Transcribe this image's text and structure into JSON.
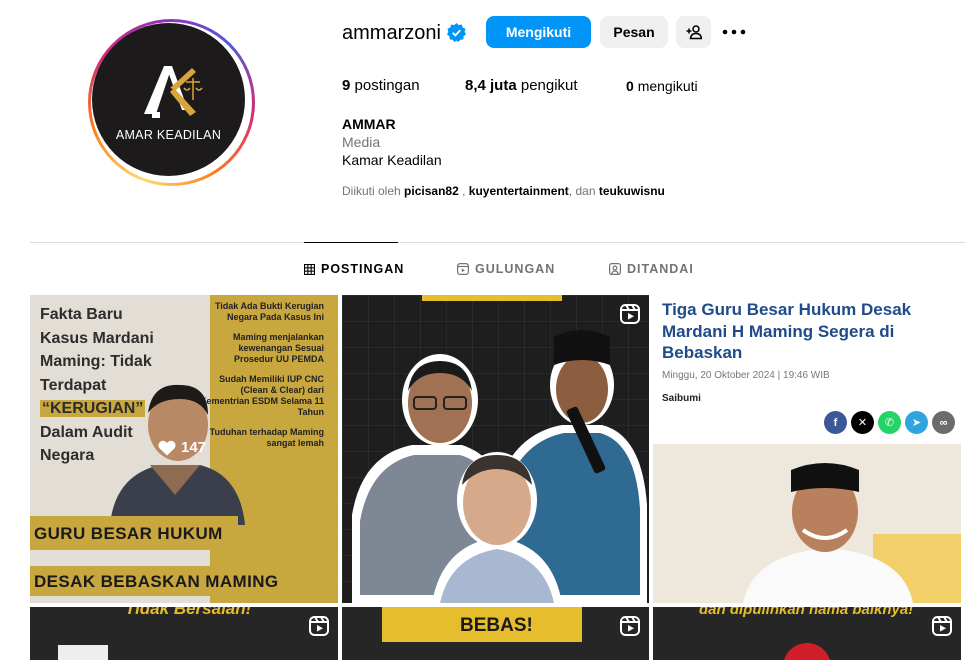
{
  "profile": {
    "avatar_text": "AMAR KEADILAN",
    "username": "ammarzoni",
    "verified": true,
    "follow_label": "Mengikuti",
    "message_label": "Pesan",
    "stats": {
      "posts_count": "9",
      "posts_label": "postingan",
      "followers_count": "8,4 juta",
      "followers_label": "pengikut",
      "following_count": "0",
      "following_label": "mengikuti"
    },
    "display_name": "AMMAR",
    "category": "Media",
    "bio": "Kamar Keadilan",
    "followed_by": {
      "prefix": "Diikuti oleh",
      "user1": "picisan82",
      "sep": ",",
      "user2": "kuyentertainment",
      "and": ", dan",
      "user3": "teukuwisnu"
    }
  },
  "tabs": [
    {
      "label": "POSTINGAN",
      "icon": "grid-icon",
      "active": true
    },
    {
      "label": "GULUNGAN",
      "icon": "reels-icon",
      "active": false
    },
    {
      "label": "DITANDAI",
      "icon": "tagged-icon",
      "active": false
    }
  ],
  "posts": [
    {
      "title_lines": [
        "Fakta Baru",
        "Kasus Mardani",
        "Maming: Tidak",
        "Terdapat"
      ],
      "highlight": "“KERUGIAN”",
      "title_tail": [
        "Dalam Audit",
        "Negara"
      ],
      "bullets": [
        "Tidak Ada Bukti Kerugian Negara Pada Kasus Ini",
        "Maming menjalankan kewenangan Sesuai Prosedur UU PEMDA",
        "Sudah Memiliki IUP CNC (Clean & Clear) dari Kementrian ESDM Selama 11 Tahun",
        "Tuduhan terhadap Maming sangat lemah"
      ],
      "banner_top": "GURU BESAR HUKUM",
      "banner_bottom": "DESAK BEBASKAN MAMING",
      "likes": "147"
    },
    {
      "type": "reel"
    },
    {
      "news_title": "Tiga Guru Besar Hukum Desak Mardani H Maming Segera di Bebaskan",
      "date": "Minggu, 20 Oktober 2024 | 19:46 WIB",
      "source": "Saibumi"
    },
    {
      "type": "reel",
      "text": "Tidak Bersalah!"
    },
    {
      "type": "reel",
      "text": "BEBAS!"
    },
    {
      "type": "reel",
      "text": "dan dipulihkan nama baiknya!"
    }
  ],
  "colors": {
    "accent": "#0095f6",
    "gold": "#c7a73e",
    "news_blue": "#1f4b8a"
  }
}
